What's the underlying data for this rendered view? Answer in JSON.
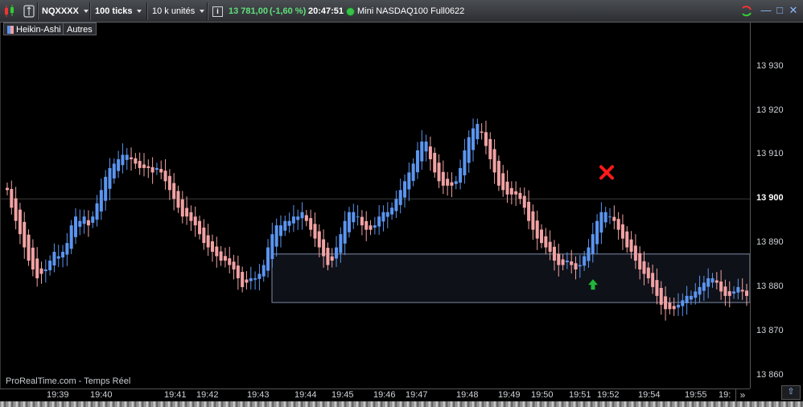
{
  "toolbar": {
    "symbol": "NQXXXX",
    "ticks": "100 ticks",
    "units": "10 k unités",
    "price": "13 781,00",
    "change": "(-1,60 %)",
    "time": "20:47:51",
    "instrument": "Mini NASDAQ100 Full0622",
    "colors": {
      "price": "#5fe07a",
      "status_dot": "#39c24a"
    }
  },
  "legend": {
    "style": "Heikin-Ashi",
    "others": "Autres"
  },
  "watermark": "ProRealTime.com - Temps Réel",
  "price_axis": {
    "labels": [
      "13 930",
      "13 920",
      "13 910",
      "13 900",
      "13 890",
      "13 880",
      "13 870",
      "13 860"
    ],
    "values": [
      13930,
      13920,
      13910,
      13900,
      13890,
      13880,
      13870,
      13860
    ],
    "highlight": "13 900"
  },
  "time_axis": {
    "labels": [
      "19:39",
      "19:40",
      "19:41",
      "19:42",
      "19:43",
      "19:44",
      "19:45",
      "19:46",
      "19:47",
      "19:48",
      "19:49",
      "19:50",
      "19:51",
      "19:52",
      "19:54",
      "19:55",
      "19:"
    ]
  },
  "chart_data": {
    "type": "candlestick",
    "style": "Heikin-Ashi",
    "y_range": [
      13857,
      13940
    ],
    "reference_line": 13900,
    "zone": {
      "low": 13876.5,
      "high": 13887.5
    },
    "colors": {
      "up": "#5b95f0",
      "down": "#f2a2a4",
      "zone_border": "#7d8ba8"
    },
    "markers": [
      {
        "type": "sell-cross",
        "color": "#ff1a1a",
        "price": 13906
      },
      {
        "type": "buy-arrow",
        "color": "#22b43a",
        "price": 13880.5
      }
    ],
    "close_path": [
      13902,
      13898,
      13895,
      13892,
      13889,
      13886,
      13884,
      13882,
      13883,
      13884,
      13886,
      13888,
      13887,
      13888,
      13890,
      13894,
      13896,
      13895,
      13896,
      13894,
      13896,
      13899,
      13902,
      13905,
      13907,
      13908,
      13909,
      13910,
      13910,
      13909,
      13908,
      13907,
      13907,
      13907,
      13906,
      13907,
      13906,
      13904,
      13902,
      13900,
      13898,
      13896,
      13896,
      13895,
      13894,
      13892,
      13890,
      13889,
      13888,
      13887,
      13886,
      13886,
      13885,
      13884,
      13882,
      13880,
      13881,
      13882,
      13882,
      13883,
      13885,
      13889,
      13892,
      13894,
      13894,
      13895,
      13895,
      13896,
      13896,
      13897,
      13895,
      13893,
      13891,
      13889,
      13887,
      13885,
      13886,
      13889,
      13892,
      13895,
      13897,
      13897,
      13896,
      13894,
      13893,
      13893,
      13894,
      13896,
      13897,
      13897,
      13898,
      13900,
      13902,
      13904,
      13906,
      13908,
      13911,
      13913,
      13913,
      13909,
      13906,
      13904,
      13903,
      13903,
      13903,
      13904,
      13907,
      13911,
      13914,
      13916,
      13917,
      13915,
      13912,
      13909,
      13906,
      13903,
      13902,
      13901,
      13901,
      13901,
      13900,
      13898,
      13895,
      13893,
      13891,
      13890,
      13889,
      13888,
      13886,
      13885,
      13885,
      13886,
      13885,
      13884,
      13885,
      13887,
      13889,
      13892,
      13895,
      13897,
      13897,
      13896,
      13895,
      13893,
      13891,
      13889,
      13888,
      13886,
      13884,
      13883,
      13882,
      13880,
      13878,
      13876,
      13875,
      13875,
      13875,
      13876,
      13877,
      13878,
      13878,
      13879,
      13880,
      13881,
      13882,
      13882,
      13881,
      13879,
      13878,
      13878,
      13879,
      13880,
      13879,
      13878
    ]
  }
}
